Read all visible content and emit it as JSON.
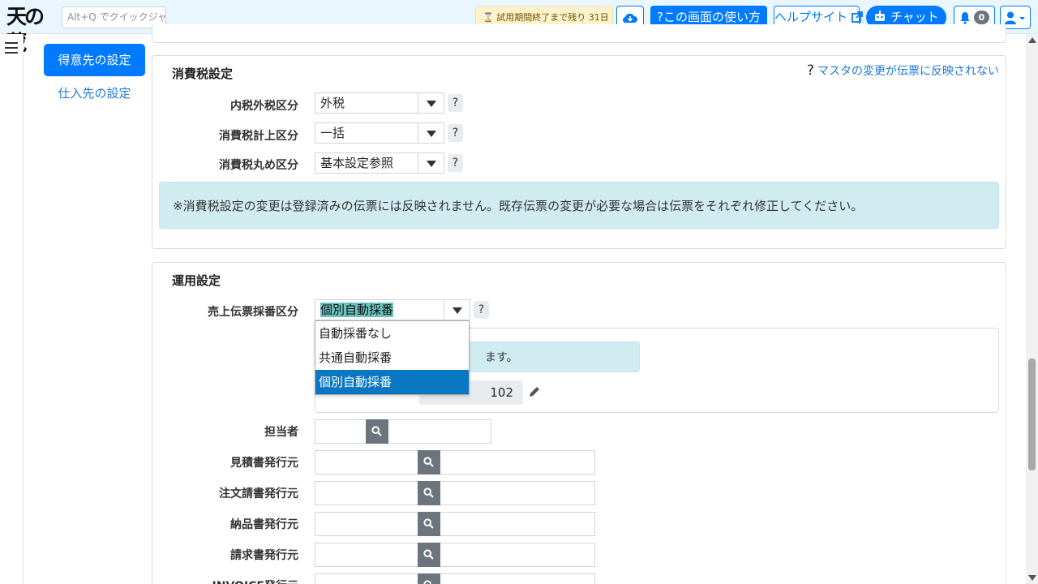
{
  "header": {
    "logo": "天の蔵",
    "quick_jump_placeholder": "Alt+Q でクイックジャンプ",
    "trial_text": "試用期間終了まで残り 31日",
    "usage_label": "この画面の使い方",
    "helpsite_label": "ヘルプサイト",
    "chat_label": "チャット",
    "notification_count": "0"
  },
  "sidebar": {
    "active_item": "得意先の設定",
    "link_item": "仕入先の設定"
  },
  "tax_settings": {
    "title": "消費税設定",
    "help_link": "マスタの変更が伝票に反映されない",
    "rows": [
      {
        "label": "内税外税区分",
        "value": "外税"
      },
      {
        "label": "消費税計上区分",
        "value": "一括"
      },
      {
        "label": "消費税丸め区分",
        "value": "基本設定参照"
      }
    ],
    "notice": "※消費税設定の変更は登録済みの伝票には反映されません。既存伝票の変更が必要な場合は伝票をそれぞれ修正してください。"
  },
  "operation_settings": {
    "title": "運用設定",
    "numbering_label": "売上伝票採番区分",
    "numbering_value": "個別自動採番",
    "numbering_options": [
      "自動採番なし",
      "共通自動採番",
      "個別自動採番"
    ],
    "partial_notice": "ます。",
    "next_number": "102",
    "fields": [
      {
        "label": "担当者"
      },
      {
        "label": "見積書発行元"
      },
      {
        "label": "注文請書発行元"
      },
      {
        "label": "納品書発行元"
      },
      {
        "label": "請求書発行元"
      },
      {
        "label": "INVOICE発行元"
      }
    ]
  },
  "colors": {
    "primary": "#007bff",
    "info_bg": "#d1ecf1",
    "dropdown_selected": "#0a77c2"
  }
}
